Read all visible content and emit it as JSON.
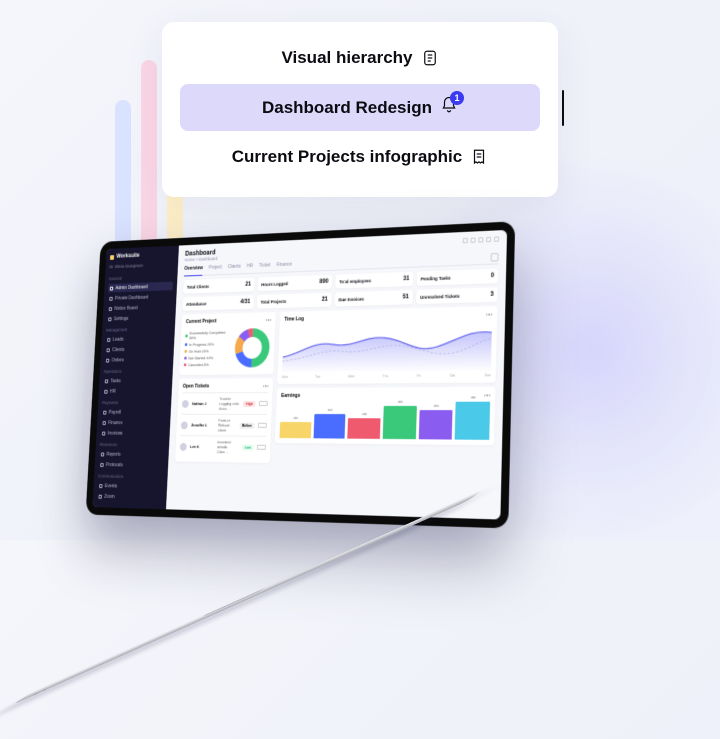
{
  "card": {
    "item1": "Visual hierarchy",
    "item2": "Dashboard Redesign",
    "item3": "Current Projects infographic",
    "badge": "1"
  },
  "dashboard": {
    "brand": "Worksuite",
    "user": "Dr. Elena Georgeson",
    "title": "Dashboard",
    "crumb": "Home > Dashboard",
    "sections": {
      "s1": "General",
      "s2": "Management",
      "s3": "Operations",
      "s4": "Payments",
      "s5": "Resources",
      "s6": "Communication"
    },
    "nav": {
      "n1": "Admin Dashboard",
      "n2": "Private Dashboard",
      "n3": "Notice Board",
      "n4": "Settings",
      "n5": "Leads",
      "n6": "Clients",
      "n7": "Orders",
      "n8": "Tasks",
      "n9": "HR",
      "n10": "Payroll",
      "n11": "Finance",
      "n12": "Invoices",
      "n13": "Reports",
      "n14": "Protocols",
      "n15": "Events",
      "n16": "Zoom"
    },
    "tabs": {
      "t1": "Overview",
      "t2": "Project",
      "t3": "Clients",
      "t4": "HR",
      "t5": "Ticket",
      "t6": "Finance"
    },
    "stats": {
      "r1": {
        "a_l": "Total Clients",
        "a_v": "21",
        "b_l": "Hours Logged",
        "b_v": "890",
        "c_l": "Total employees",
        "c_v": "31",
        "d_l": "Pending Tasks",
        "d_v": "0"
      },
      "r2": {
        "a_l": "Attendance",
        "a_v": "4/31",
        "b_l": "Total Projects",
        "b_v": "21",
        "c_l": "Due Invoices",
        "d_v": "51",
        "c_v": "51",
        "d_l": "Unresolved Tickets",
        "dv": "3"
      }
    },
    "project": {
      "title": "Current Project",
      "l1": "Successfully Completed 50%",
      "l2": "In Progress 20%",
      "l3": "On Hold 15%",
      "l4": "Not Started 10%",
      "l5": "Cancelled 5%"
    },
    "timelog": {
      "title": "Time Log",
      "x1": "Mon",
      "x2": "Tue",
      "x3": "Wed",
      "x4": "Thu",
      "x5": "Fri",
      "x6": "Sat",
      "x7": "Sun"
    },
    "tickets": {
      "title": "Open Tickets",
      "r1_name": "Nathan J",
      "r1_txt": "Trouble Logging onto Acco…",
      "r1_pri": "High",
      "r2_name": "Jennifer L",
      "r2_txt": "Feature Refund client",
      "r2_pri": "Before",
      "r3_name": "Lee K",
      "r3_txt": "Incorrect details Clien…",
      "r3_pri": "Low"
    },
    "earnings": {
      "title": "Earnings",
      "b1": "200",
      "b2": "300",
      "b3": "250",
      "b4": "400",
      "b5": "350",
      "b6": "450"
    }
  },
  "colors": {
    "green": "#3ac97a",
    "blue": "#4a6cff",
    "purple": "#8a5cf0",
    "orange": "#f6a94b",
    "red": "#ef5a6f",
    "yellow": "#f8d568",
    "cyan": "#4ac9e8"
  }
}
